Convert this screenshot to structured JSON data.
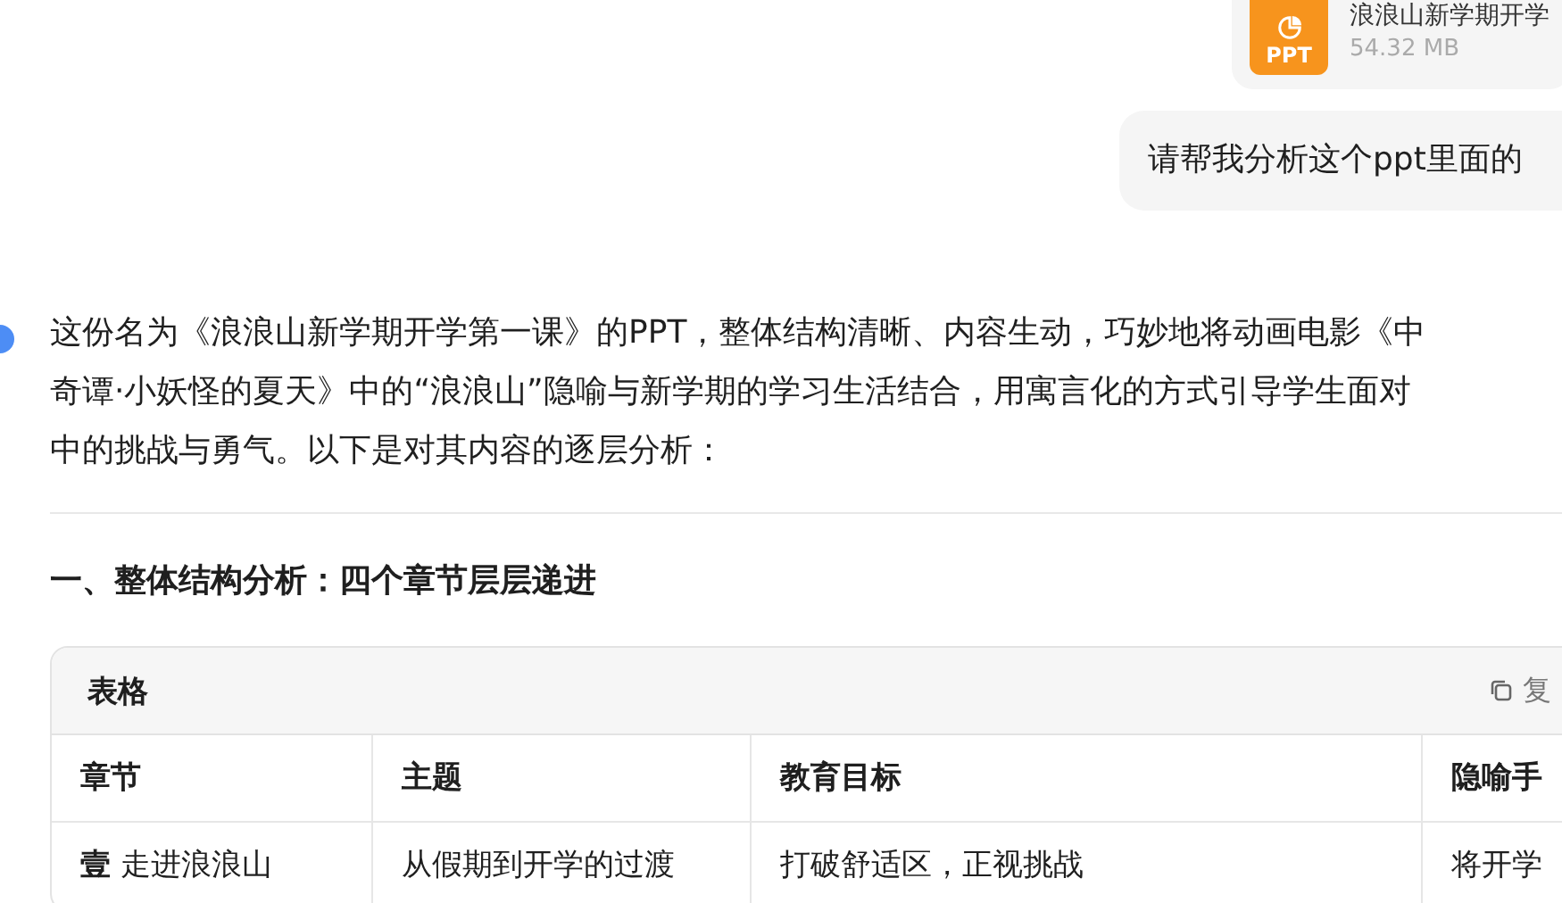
{
  "attachment": {
    "badge": "PPT",
    "name": "浪浪山新学期开学",
    "size": "54.32 MB"
  },
  "user_message": "请帮我分析这个ppt里面的",
  "answer": {
    "lines": [
      "这份名为《浪浪山新学期开学第一课》的PPT，整体结构清晰、内容生动，巧妙地将动画电影《中",
      "奇谭·小妖怪的夏天》中的“浪浪山”隐喻与新学期的学习生活结合，用寓言化的方式引导学生面对",
      "中的挑战与勇气。以下是对其内容的逐层分析："
    ],
    "heading": "一、整体结构分析：四个章节层层递进",
    "table": {
      "title": "表格",
      "copy_label": "复",
      "columns": [
        "章节",
        "主题",
        "教育目标",
        "隐喻手"
      ],
      "rows": [
        [
          "**壹** 走进浪浪山",
          "从假期到开学的过渡",
          "打破舒适区，正视挑战",
          "将开学"
        ]
      ]
    }
  }
}
